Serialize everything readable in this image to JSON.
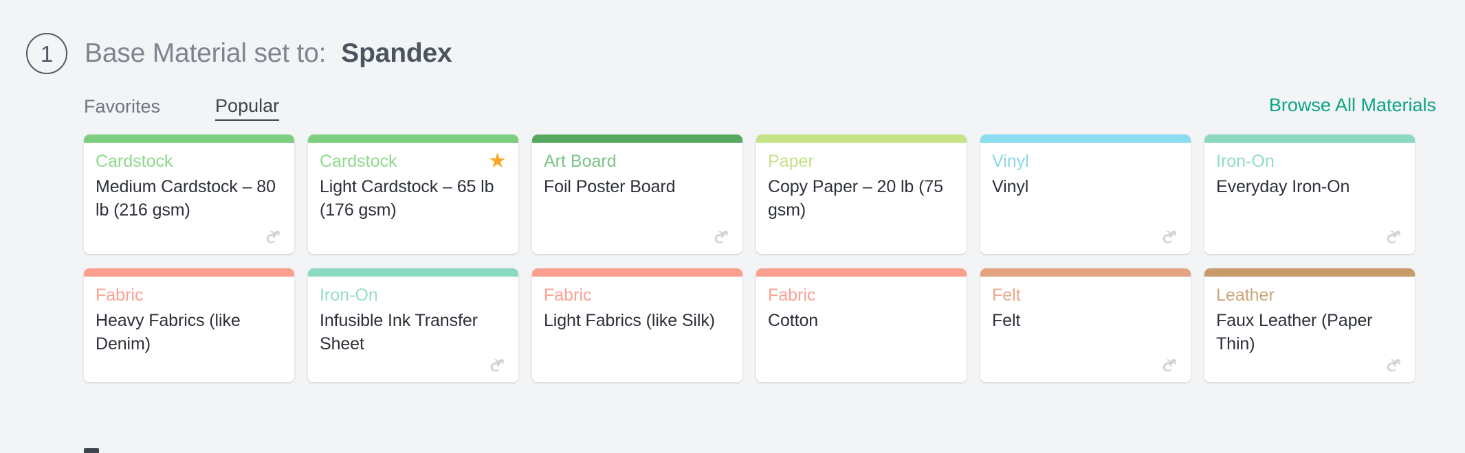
{
  "header": {
    "step_number": "1",
    "label": "Base Material set to:",
    "value": "Spandex"
  },
  "tabs": {
    "favorites": "Favorites",
    "popular": "Popular",
    "active": "Popular"
  },
  "browse_link": "Browse All Materials",
  "colors": {
    "page_background": "#f2f4f6",
    "accent_link": "#0aa583",
    "star": "#f9a825",
    "text_primary": "#2c3038",
    "text_muted": "#7d8590"
  },
  "cards": [
    {
      "category": "Cardstock",
      "title": "Medium Cardstock – 80 lb (216 gsm)",
      "bar_color": "#7dce7e",
      "category_color": "#8ed98b",
      "favorite": false,
      "cricut_logo": true
    },
    {
      "category": "Cardstock",
      "title": "Light Cardstock – 65 lb (176 gsm)",
      "bar_color": "#7dce7e",
      "category_color": "#8ed98b",
      "favorite": true,
      "cricut_logo": false
    },
    {
      "category": "Art Board",
      "title": "Foil Poster Board",
      "bar_color": "#57a85f",
      "category_color": "#7cc487",
      "favorite": false,
      "cricut_logo": true
    },
    {
      "category": "Paper",
      "title": "Copy Paper – 20 lb (75 gsm)",
      "bar_color": "#c5e487",
      "category_color": "#c3e287",
      "favorite": false,
      "cricut_logo": false
    },
    {
      "category": "Vinyl",
      "title": "Vinyl",
      "bar_color": "#8adcee",
      "category_color": "#8ad8ec",
      "favorite": false,
      "cricut_logo": true
    },
    {
      "category": "Iron-On",
      "title": "Everyday Iron-On",
      "bar_color": "#8cd9c2",
      "category_color": "#93dcc4",
      "favorite": false,
      "cricut_logo": true
    },
    {
      "category": "Fabric",
      "title": "Heavy Fabrics (like Denim)",
      "bar_color": "#fa9e8d",
      "category_color": "#fba294",
      "favorite": false,
      "cricut_logo": false
    },
    {
      "category": "Iron-On",
      "title": "Infusible Ink Transfer Sheet",
      "bar_color": "#8cd9c2",
      "category_color": "#93dcc4",
      "favorite": false,
      "cricut_logo": true
    },
    {
      "category": "Fabric",
      "title": "Light Fabrics (like Silk)",
      "bar_color": "#fa9e8d",
      "category_color": "#fba294",
      "favorite": false,
      "cricut_logo": false
    },
    {
      "category": "Fabric",
      "title": "Cotton",
      "bar_color": "#fa9e8d",
      "category_color": "#fba294",
      "favorite": false,
      "cricut_logo": false
    },
    {
      "category": "Felt",
      "title": "Felt",
      "bar_color": "#e3a280",
      "category_color": "#e8aa8a",
      "favorite": false,
      "cricut_logo": true
    },
    {
      "category": "Leather",
      "title": "Faux Leather (Paper Thin)",
      "bar_color": "#c79a6a",
      "category_color": "#cda477",
      "favorite": false,
      "cricut_logo": true
    }
  ]
}
